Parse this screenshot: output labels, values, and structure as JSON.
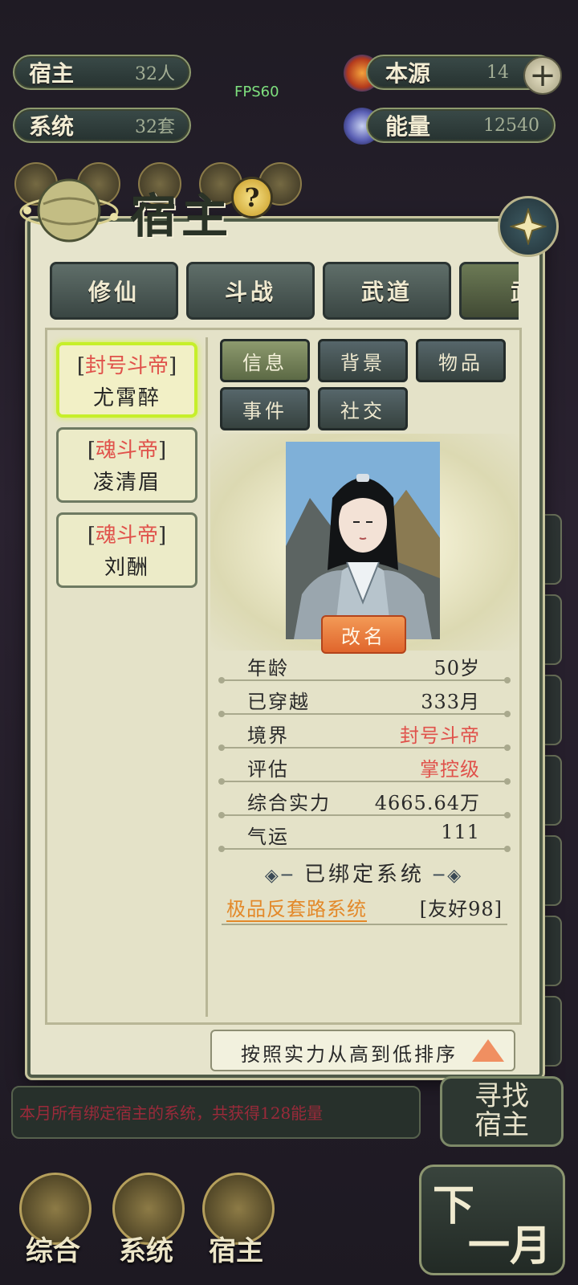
{
  "top_stats": {
    "host": {
      "label": "宿主",
      "value": "32人"
    },
    "system": {
      "label": "系统",
      "value": "32套"
    },
    "origin": {
      "label": "本源",
      "value": "14"
    },
    "energy": {
      "label": "能量",
      "value": "12540"
    },
    "fps": "FPS60"
  },
  "dialog": {
    "title": "宿主",
    "help_symbol": "?",
    "category_tabs": [
      "修仙",
      "斗战",
      "武道",
      "武"
    ],
    "host_list": [
      {
        "rank": "封号斗帝",
        "name": "尤霄醉"
      },
      {
        "rank": "魂斗帝",
        "name": "凌清眉"
      },
      {
        "rank": "魂斗帝",
        "name": "刘酬"
      }
    ],
    "info_tabs": [
      "信息",
      "背景",
      "物品",
      "事件",
      "社交"
    ],
    "rename_label": "改名",
    "stats": [
      {
        "label": "年龄",
        "value": "50岁"
      },
      {
        "label": "已穿越",
        "value": "333月"
      },
      {
        "label": "境界",
        "value": "封号斗帝"
      },
      {
        "label": "评估",
        "value": "掌控级"
      },
      {
        "label": "综合实力",
        "value": "4665.64万"
      },
      {
        "label": "气运",
        "value": "111"
      }
    ],
    "bound_system_heading": "已绑定系统",
    "bound_system_name": "极品反套路系统",
    "bound_system_friendliness": "[友好98]",
    "sort_label": "按照实力从高到低排序"
  },
  "background": {
    "notice": "本月所有绑定宿主的系统，共获得128能量",
    "find_host": {
      "line1": "寻找",
      "line2": "宿主"
    },
    "bottom_nav": [
      "综合",
      "系统",
      "宿主"
    ],
    "next_month": {
      "line1": "下",
      "line2": "一月"
    }
  },
  "colors": {
    "accent_red": "#e0524b",
    "accent_orange": "#e3892a",
    "selected_glow": "#c6ef2a"
  }
}
